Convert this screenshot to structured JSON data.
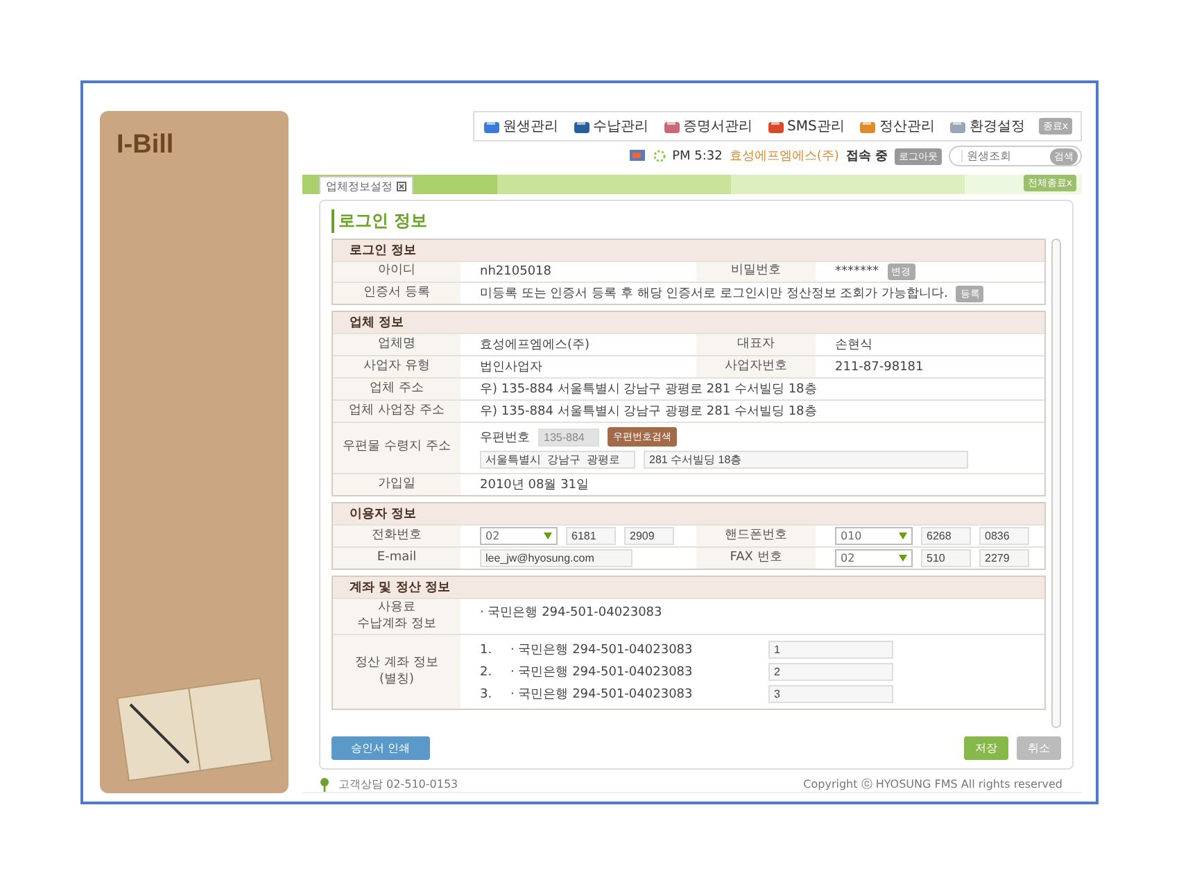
{
  "logo": "I-Bill",
  "menu": [
    {
      "label": "원생관리"
    },
    {
      "label": "수납관리"
    },
    {
      "label": "증명서관리"
    },
    {
      "label": "SMS관리"
    },
    {
      "label": "정산관리"
    },
    {
      "label": "환경설정"
    }
  ],
  "menu_close": "종료x",
  "status": {
    "time": "PM 5:32",
    "company": "효성에프엠에스(주)",
    "state": "접속 중",
    "logout": "로그아웃",
    "search_placeholder": "원생조회",
    "search_button": "검색"
  },
  "tabs": [
    {
      "label": "업체정보설정",
      "selected": true
    }
  ],
  "close_all": "전체종료x",
  "page_title": "로그인 정보",
  "sections": [
    {
      "title": "로그인 정보",
      "rows": [
        [
          {
            "kind": "text",
            "label": "아이디",
            "value": "nh2105018"
          },
          {
            "kind": "text",
            "label": "비밀번호",
            "value": "*******",
            "button": "변경"
          }
        ],
        [
          {
            "kind": "text",
            "label": "인증서 등록",
            "value": "미등록 또는 인증서 등록 후 해당 인증서로 로그인시만 정산정보 조회가 가능합니다.",
            "button": "등록"
          }
        ]
      ]
    },
    {
      "title": "업체 정보",
      "rows": [
        [
          {
            "kind": "text",
            "label": "업체명",
            "value": "효성에프엠에스(주)"
          },
          {
            "kind": "text",
            "label": "대표자",
            "value": "손현식"
          }
        ],
        [
          {
            "kind": "text",
            "label": "사업자 유형",
            "value": "법인사업자"
          },
          {
            "kind": "text",
            "label": "사업자번호",
            "value": "211-87-98181"
          }
        ],
        [
          {
            "kind": "text",
            "label": "업체 주소",
            "value": "우) 135-884 서울특별시  강남구  광평로 281  수서빌딩 18층"
          }
        ],
        [
          {
            "kind": "text",
            "label": "업체 사업장 주소",
            "value": "우) 135-884 서울특별시  강남구  광평로 281  수서빌딩 18층"
          }
        ],
        [
          {
            "kind": "zip",
            "label": "우편물 수령지 주소",
            "zip_label": "우편번호",
            "zip_value": "135-884",
            "button": "우편번호검색",
            "address": [
              "서울특별시  강남구  광평로",
              "281 수서빌딩 18층"
            ]
          }
        ],
        [
          {
            "kind": "text",
            "label": "가입일",
            "value": "2010년 08월 31일"
          }
        ]
      ]
    },
    {
      "title": "이용자 정보",
      "rows": [
        [
          {
            "kind": "phone",
            "label": "전화번호",
            "select": "02",
            "parts": [
              "6181",
              "2909"
            ]
          },
          {
            "kind": "phone",
            "label": "핸드폰번호",
            "select": "010",
            "parts": [
              "6268",
              "0836"
            ]
          }
        ],
        [
          {
            "kind": "input",
            "label": "E-mail",
            "value": "lee_jw@hyosung.com"
          },
          {
            "kind": "phone",
            "label": "FAX 번호",
            "select": "02",
            "parts": [
              "510",
              "2279"
            ]
          }
        ]
      ]
    },
    {
      "title": "계좌 및 정산 정보",
      "rows": [
        [
          {
            "kind": "list",
            "label": "사용료\n수납계좌 정보",
            "items": [
              "· 국민은행 294-501-04023083"
            ]
          }
        ],
        [
          {
            "kind": "numbered",
            "label": "정산 계좌 정보\n(별칭)",
            "items": [
              {
                "number": "1.",
                "account": "· 국민은행 294-501-04023083",
                "alias": "1"
              },
              {
                "number": "2.",
                "account": "· 국민은행 294-501-04023083",
                "alias": "2"
              },
              {
                "number": "3.",
                "account": "· 국민은행 294-501-04023083",
                "alias": "3"
              }
            ]
          }
        ]
      ]
    }
  ],
  "actions": {
    "print": "승인서 인쇄",
    "save": "저장",
    "cancel": "취소"
  },
  "footer": {
    "contact": "고객상담 02-510-0153",
    "copyright": "Copyright ⓒ HYOSUNG FMS All rights reserved"
  }
}
